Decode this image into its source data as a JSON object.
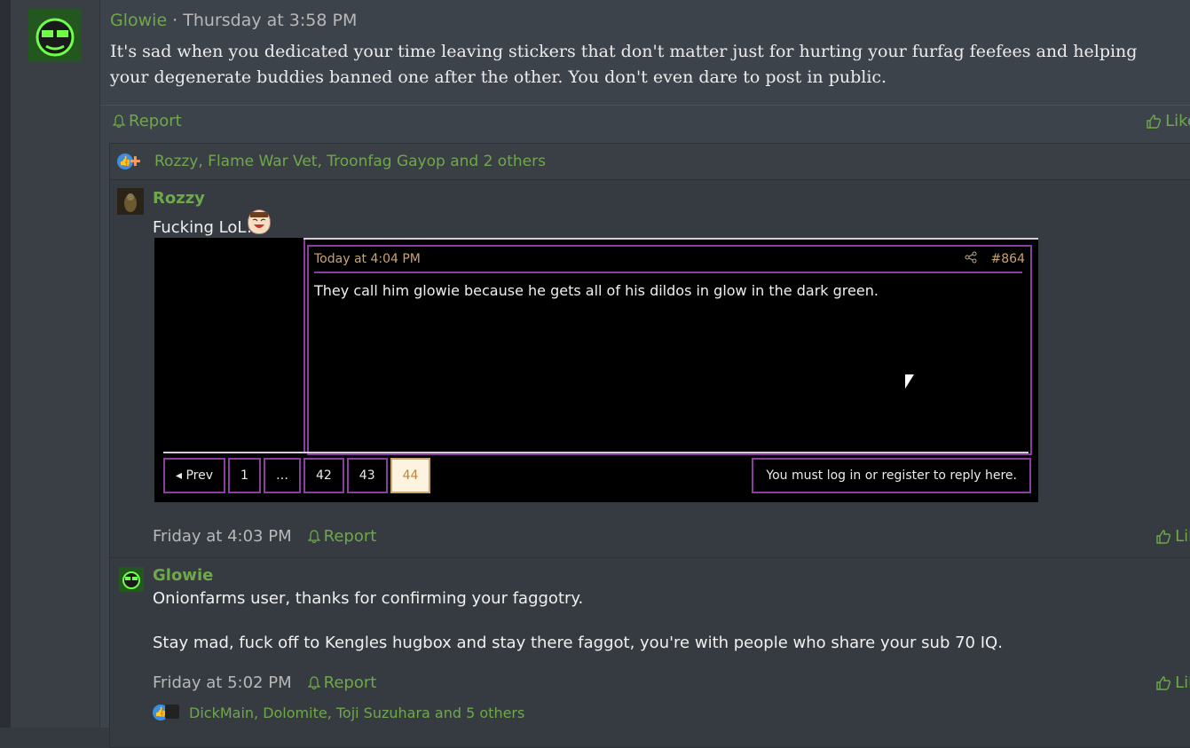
{
  "post": {
    "author": "Glowie",
    "separator": " · ",
    "date": "Thursday at 3:58 PM",
    "body": "It's sad when you dedicated your time leaving stickers that don't matter just for hurting your furfag feefees and helping your degenerate buddies banned one after the other. You don't even dare to post in public.",
    "report_label": "Report",
    "like_label": "Like",
    "reactions_text": "Rozzy, Flame War Vet, Troonfag Gayop and 2 others"
  },
  "comments": [
    {
      "author": "Rozzy",
      "text": "Fucking LoL!",
      "date": "Friday at 4:03 PM",
      "report_label": "Report",
      "like_label": "Like",
      "screenshot": {
        "date": "Today at 4:04 PM",
        "post_id": "#864",
        "message": "They call him glowie because he gets all of his dildos in glow in the dark green.",
        "pager": [
          "◂ Prev",
          "1",
          "…",
          "42",
          "43",
          "44"
        ],
        "current_page": "44",
        "login_text": "You must log in or register to reply here."
      }
    },
    {
      "author": "Glowie",
      "line1": "Onionfarms user, thanks for confirming your faggotry.",
      "line2": "Stay mad, fuck off to Kengles hugbox and stay there faggot, you're with people who share your sub 70 IQ.",
      "date": "Friday at 5:02 PM",
      "report_label": "Report",
      "like_label": "Like",
      "reactions_text": "DickMain, Dolomite, Toji Suzuhara and 5 others"
    }
  ],
  "icons": {
    "bell": "bell-icon",
    "thumb": "thumbs-up-icon",
    "share": "share-icon"
  },
  "colors": {
    "accent": "#6ea84a",
    "background": "#353a41",
    "screenshot_border": "#8a3fa0"
  }
}
